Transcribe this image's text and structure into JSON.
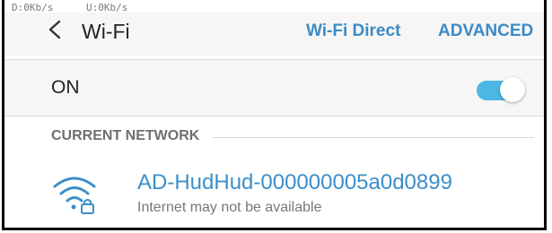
{
  "status_bar": {
    "download": "D:0Kb/s",
    "upload": "U:0Kb/s"
  },
  "header": {
    "title": "Wi-Fi",
    "wifi_direct_label": "Wi-Fi Direct",
    "advanced_label": "ADVANCED"
  },
  "master_switch": {
    "label": "ON",
    "enabled": true
  },
  "current_network": {
    "section_title": "CURRENT NETWORK",
    "ssid": "AD-HudHud-000000005a0d0899",
    "status": "Internet may not be available",
    "icon": "wifi-locked-icon"
  },
  "colors": {
    "accent": "#3c8bc6",
    "toggle_on": "#4bb8e3"
  }
}
